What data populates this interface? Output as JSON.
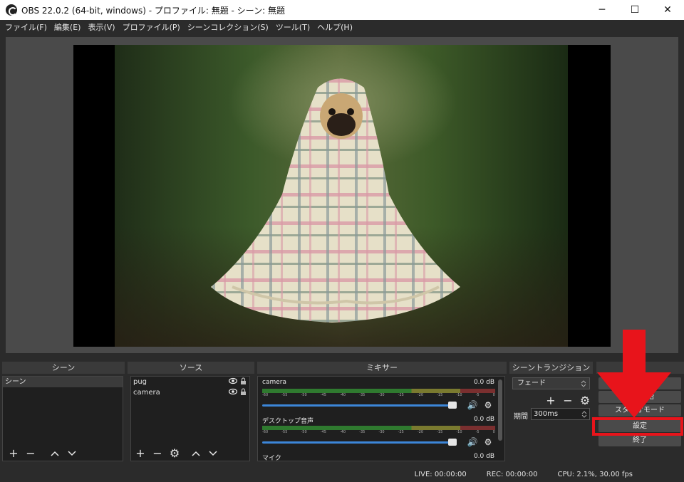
{
  "window": {
    "title": "OBS 22.0.2 (64-bit, windows) - プロファイル: 無題 - シーン: 無題",
    "minimize_glyph": "─",
    "maximize_glyph": "☐",
    "close_glyph": "✕"
  },
  "menu": {
    "items": [
      "ファイル(F)",
      "編集(E)",
      "表示(V)",
      "プロファイル(P)",
      "シーンコレクション(S)",
      "ツール(T)",
      "ヘルプ(H)"
    ]
  },
  "docks": {
    "scenes": {
      "title": "シーン",
      "items": [
        "シーン"
      ]
    },
    "sources": {
      "title": "ソース",
      "items": [
        "pug",
        "camera"
      ]
    },
    "mixer": {
      "title": "ミキサー",
      "channels": [
        {
          "name": "camera",
          "db": "0.0 dB"
        },
        {
          "name": "デスクトップ音声",
          "db": "0.0 dB"
        },
        {
          "name": "マイク",
          "db": "0.0 dB"
        }
      ],
      "ticks": [
        "-60",
        "-55",
        "-50",
        "-45",
        "-40",
        "-35",
        "-30",
        "-25",
        "-20",
        "-15",
        "-10",
        "-5",
        "0"
      ]
    },
    "transitions": {
      "title": "シーントランジション",
      "selected": "フェード",
      "duration_label": "期間",
      "duration_value": "300ms"
    },
    "controls": {
      "title": "",
      "buttons": [
        "録画開始",
        "スタジオモード",
        "設定",
        "終了"
      ]
    }
  },
  "status": {
    "live": "LIVE: 00:00:00",
    "rec": "REC: 00:00:00",
    "cpu": "CPU: 2.1%, 30.00 fps"
  },
  "colors": {
    "annotation": "#e8141b",
    "slider": "#3c86d8"
  },
  "icons": {
    "add": "+",
    "remove": "−",
    "up": "^",
    "down": "v",
    "gear": "⚙",
    "speaker": "🔊",
    "eye": "👁",
    "lock": "🔒"
  }
}
